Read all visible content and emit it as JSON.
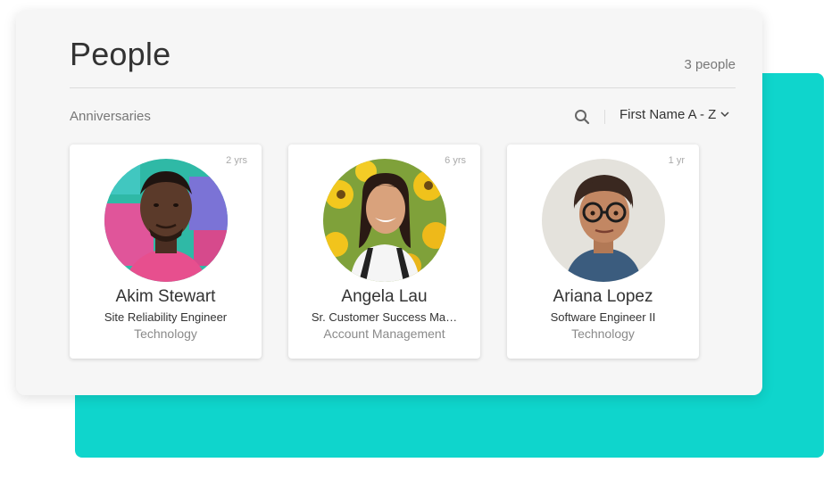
{
  "header": {
    "title": "People",
    "count_label": "3 people"
  },
  "toolbar": {
    "section_label": "Anniversaries",
    "search_icon": "search-icon",
    "sort_label": "First Name A - Z",
    "sort_icon": "chevron-down-icon"
  },
  "colors": {
    "accent": "#0fd5cc",
    "panel_bg": "#f6f6f6"
  },
  "people": [
    {
      "name": "Akim Stewart",
      "title": "Site Reliability Engineer",
      "department": "Technology",
      "tenure": "2 yrs"
    },
    {
      "name": "Angela Lau",
      "title": "Sr. Customer Success Ma…",
      "department": "Account Management",
      "tenure": "6 yrs"
    },
    {
      "name": "Ariana Lopez",
      "title": "Software Engineer II",
      "department": "Technology",
      "tenure": "1 yr"
    }
  ]
}
